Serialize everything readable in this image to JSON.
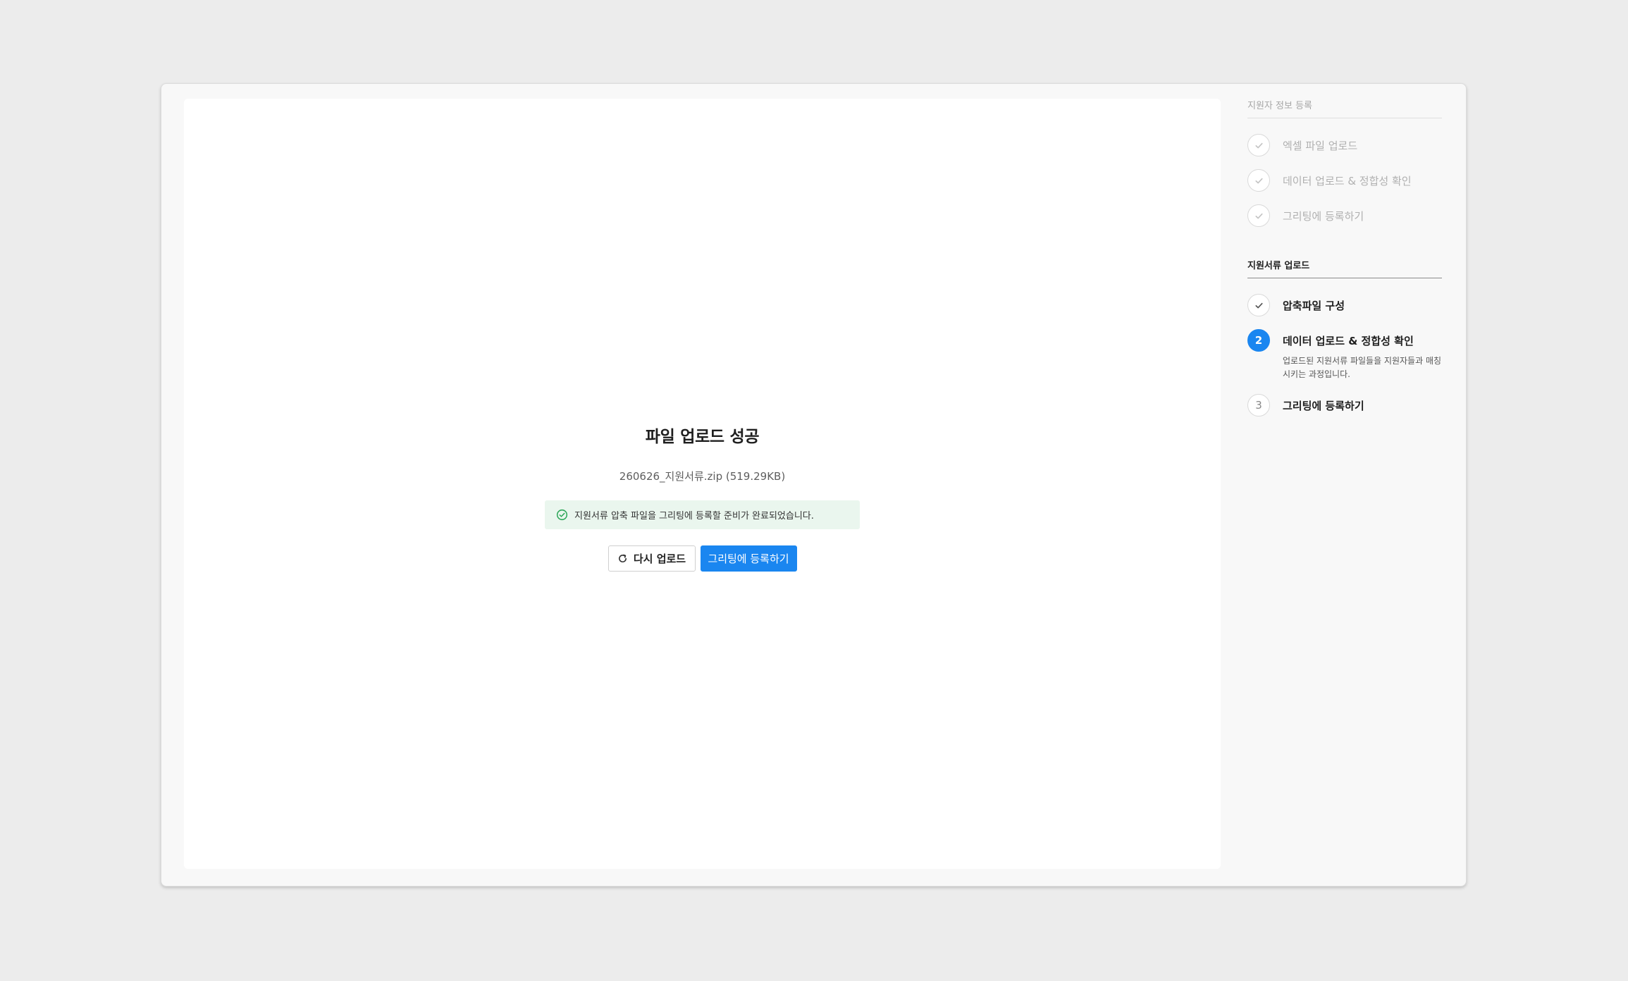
{
  "result": {
    "title": "파일 업로드 성공",
    "file_info": "260626_지원서류.zip (519.29KB)",
    "alert": "지원서류 압축 파일을 그리팅에 등록할 준비가 완료되었습니다.",
    "retry_label": "다시 업로드",
    "register_label": "그리팅에 등록하기"
  },
  "sidebar": {
    "section1": {
      "title": "지원자 정보 등록",
      "steps": [
        {
          "label": "엑셀 파일 업로드",
          "status": "done"
        },
        {
          "label": "데이터 업로드 & 정합성 확인",
          "status": "done"
        },
        {
          "label": "그리팅에 등록하기",
          "status": "done"
        }
      ]
    },
    "section2": {
      "title": "지원서류 업로드",
      "steps": [
        {
          "label": "압축파일 구성",
          "status": "done"
        },
        {
          "number": "2",
          "label": "데이터 업로드 & 정합성 확인",
          "status": "current",
          "description": "업로드된 지원서류 파일들을 지원자들과 매칭시키는 과정입니다."
        },
        {
          "number": "3",
          "label": "그리팅에 등록하기",
          "status": "pending"
        }
      ]
    }
  },
  "colors": {
    "primary": "#1a86f0",
    "success_bg": "#eaf6ee",
    "success_icon": "#2fa85a"
  }
}
